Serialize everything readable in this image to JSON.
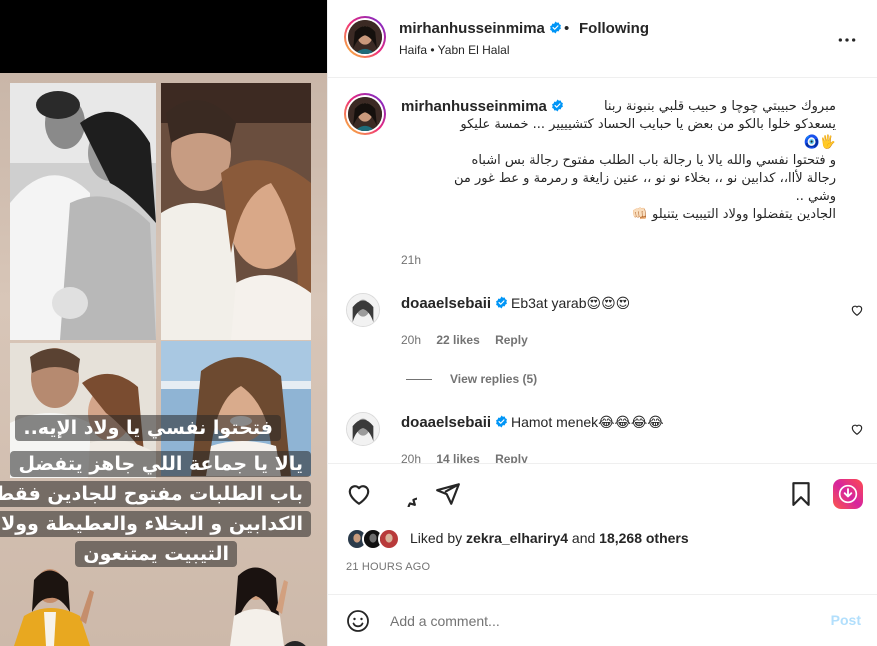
{
  "post": {
    "username": "mirhanhusseinmima",
    "dot": "•",
    "following_label": "Following",
    "location": "Haifa • Yabn El Halal"
  },
  "media": {
    "caption_lines": [
      "فتحتوا نفسي يا ولاد الإيه..",
      "يالا يا جماعة اللي جاهز يتفضل",
      "باب الطلبات مفتوح للجادين فقط",
      "الكدابين و البخلاء والعطيطة وولاد",
      "التيبيت يمتنعون"
    ],
    "mute_icon": "speaker-muted-icon"
  },
  "caption": {
    "username": "mirhanhusseinmima",
    "lines": [
      "مبروك حبيبتي چوچا و حبيب قلبي بنبونة ربنا",
      "يسعدكو خلوا بالكو من بعض يا حبايب الحساد كتشيييير ... خمسة عليكو",
      "🖐🧿",
      "و فتحتوا نفسي والله يالا يا رجالة باب الطلب مفتوح رجالة بس اشباه",
      "رجالة لأاا،، كدابين نو ،، بخلاء نو نو ،، عنين زايغة و رمرمة و عط غور من",
      "وشي ..",
      "الجادين يتفضلوا وولاد التيبيت يتنيلو 👊🏻"
    ],
    "time": "21h"
  },
  "comments": [
    {
      "username": "doaaelsebaii",
      "text": "Eb3at yarab😍😍😍",
      "time": "20h",
      "likes": "22 likes",
      "reply": "Reply"
    },
    {
      "username": "doaaelsebaii",
      "text": "Hamot menek😂😂😂😂",
      "time": "20h",
      "likes": "14 likes",
      "reply": "Reply"
    }
  ],
  "view_replies": "View replies (5)",
  "likes": {
    "prefix": "Liked by",
    "user": "zekra_elhariry4",
    "and": "and",
    "others": "18,268 others"
  },
  "date": "21 HOURS AGO",
  "composer": {
    "placeholder": "Add a comment...",
    "post_label": "Post"
  },
  "colors": {
    "verified": "#0095f6",
    "link_disabled": "#b2dffc",
    "muted_text": "#737373"
  }
}
